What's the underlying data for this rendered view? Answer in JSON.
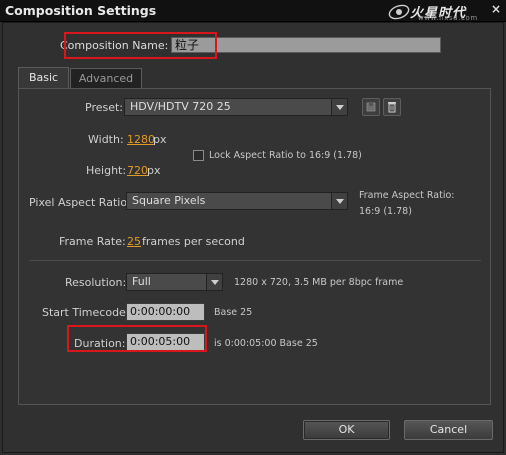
{
  "window": {
    "title": "Composition Settings",
    "brand_text": "火星时代",
    "brand_url": "www.hxsd.com",
    "close_glyph": "×"
  },
  "composition_name": {
    "label": "Composition Name:",
    "value": "粒子"
  },
  "tabs": [
    {
      "label": "Basic",
      "active": true
    },
    {
      "label": "Advanced",
      "active": false
    }
  ],
  "basic": {
    "preset": {
      "label": "Preset:",
      "value": "HDV/HDTV 720 25"
    },
    "width": {
      "label": "Width:",
      "value": "1280",
      "unit": "px"
    },
    "height": {
      "label": "Height:",
      "value": "720",
      "unit": "px"
    },
    "lock_aspect": {
      "label": "Lock Aspect Ratio to 16:9 (1.78)",
      "checked": false
    },
    "pixel_aspect": {
      "label": "Pixel Aspect Ratio:",
      "value": "Square Pixels"
    },
    "frame_aspect": {
      "label": "Frame Aspect Ratio:",
      "value": "16:9 (1.78)"
    },
    "frame_rate": {
      "label": "Frame Rate:",
      "value": "25",
      "unit": "frames per second"
    },
    "resolution": {
      "label": "Resolution:",
      "value": "Full",
      "info": "1280 x 720, 3.5 MB per 8bpc frame"
    },
    "start_timecode": {
      "label": "Start Timecode:",
      "value": "0:00:00:00",
      "base": "Base 25"
    },
    "duration": {
      "label": "Duration:",
      "value": "0:00:05:00",
      "info": "is 0:00:05:00  Base 25"
    }
  },
  "buttons": {
    "ok": "OK",
    "cancel": "Cancel"
  },
  "colors": {
    "accent_value": "#e29a22",
    "highlight_box": "#d8161b"
  }
}
